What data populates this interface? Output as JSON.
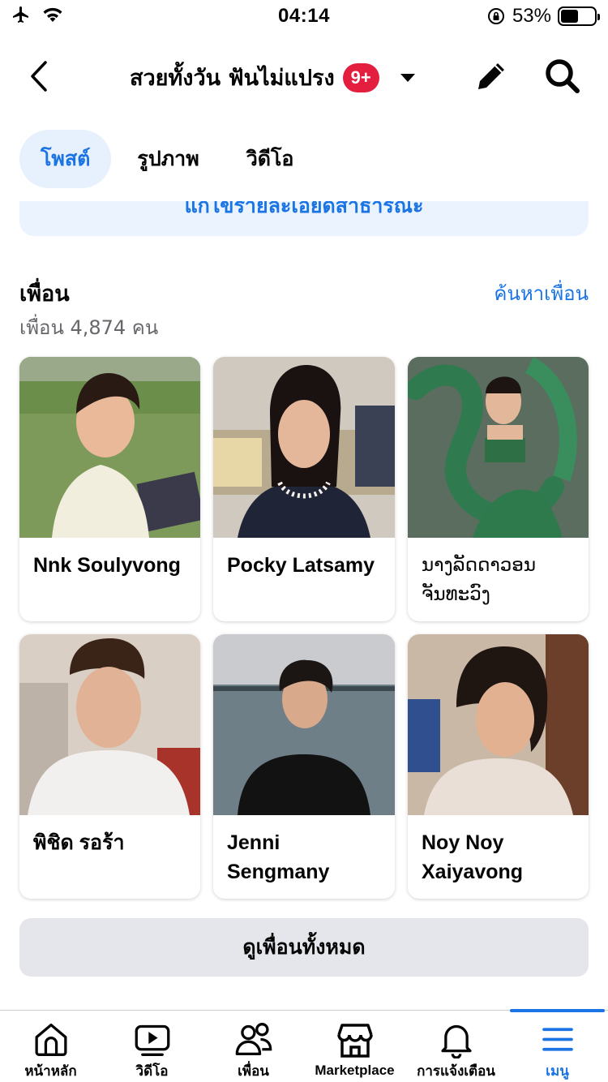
{
  "status_bar": {
    "time": "04:14",
    "battery_percent": "53%",
    "battery_level": 0.53,
    "icons": [
      "airplane-icon",
      "wifi-icon",
      "orientation-lock-icon",
      "battery-icon"
    ]
  },
  "header": {
    "group_title": "สวยทั้งวัน ฟันไม่แปรง",
    "badge": "9+",
    "icons": [
      "back-chevron-icon",
      "dropdown-caret-icon",
      "pencil-icon",
      "search-icon"
    ]
  },
  "tabs": [
    {
      "label": "โพสต์",
      "active": true
    },
    {
      "label": "รูปภาพ",
      "active": false
    },
    {
      "label": "วิดีโอ",
      "active": false
    }
  ],
  "info_banner": {
    "text": "แก้ไขรายละเอียดสาธารณะ"
  },
  "friends": {
    "heading": "เพื่อน",
    "count_text": "เพื่อน 4,874 คน",
    "find_link": "ค้นหาเพื่อน",
    "cards": [
      {
        "name": "Nnk Soulyvong"
      },
      {
        "name": "Pocky Latsamy"
      },
      {
        "name": "ນາງລັດດາວອນ ຈັນທະວົງ"
      },
      {
        "name": "พิชิด รอร้า"
      },
      {
        "name": "Jenni Sengmany"
      },
      {
        "name": "Noy Noy Xaiyavong"
      }
    ],
    "see_all": "ดูเพื่อนทั้งหมด"
  },
  "bottom_nav": [
    {
      "label": "หน้าหลัก",
      "icon": "home-icon",
      "active": false
    },
    {
      "label": "วิดีโอ",
      "icon": "video-icon",
      "active": false
    },
    {
      "label": "เพื่อน",
      "icon": "friends-icon",
      "active": false
    },
    {
      "label": "Marketplace",
      "icon": "marketplace-icon",
      "active": false
    },
    {
      "label": "การแจ้งเตือน",
      "icon": "bell-icon",
      "active": false
    },
    {
      "label": "เมนู",
      "icon": "menu-icon",
      "active": true
    }
  ],
  "colors": {
    "accent": "#1b74e4",
    "badge": "#e41e3f",
    "tab_active_bg": "#e7f0fd",
    "button_bg": "#e4e6eb",
    "secondary_text": "#65676b"
  }
}
